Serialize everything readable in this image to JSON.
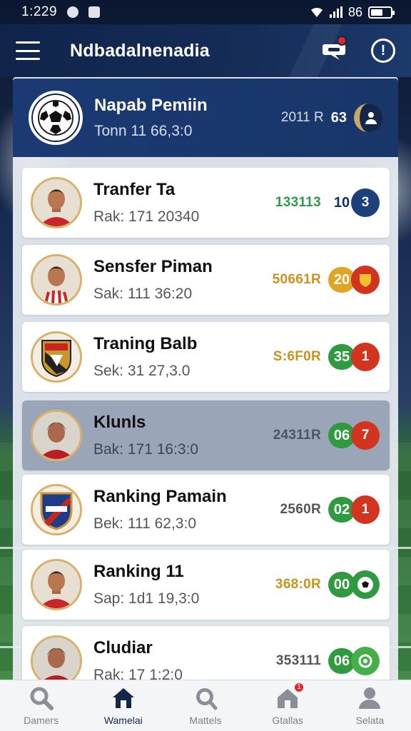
{
  "status_bar": {
    "time": "1:229",
    "battery_text": "86"
  },
  "header": {
    "title": "Ndbadalnenadia"
  },
  "featured": {
    "name": "Napab Pemiin",
    "sub": "Tonn 11 66,3:0",
    "value": "2011 R",
    "score": "63"
  },
  "rows": [
    {
      "name": "Tranfer Ta",
      "sub": "Rak: 171 20340",
      "value": "133113",
      "value_color": "#2e9a4b",
      "num": "10",
      "num_color": "transparent",
      "num_text_color": "#14306a",
      "tag": "3",
      "tag_color": "#1d3f7a",
      "avatar": "player"
    },
    {
      "name": "Sensfer Piman",
      "sub": "Sak: 111 36:20",
      "value": "50661R",
      "value_color": "#c9931c",
      "num": "20",
      "num_color": "#e0a524",
      "num_text_color": "#ffffff",
      "tag": "",
      "tag_color": "#d2341f",
      "avatar": "player-stripe"
    },
    {
      "name": "Traning Balb",
      "sub": "Sek: 31 27,3.0",
      "value": "S:6F0R",
      "value_color": "#c9931c",
      "num": "35",
      "num_color": "#2f9a3f",
      "num_text_color": "#ffffff",
      "tag": "1",
      "tag_color": "#d2341f",
      "avatar": "crest-red"
    },
    {
      "name": "Klunls",
      "sub": "Bak: 171 16:3:0",
      "value": "24311R",
      "value_color": "#4b5565",
      "num": "06",
      "num_color": "#2f9a3f",
      "num_text_color": "#ffffff",
      "tag": "7",
      "tag_color": "#d2341f",
      "avatar": "player-dark"
    },
    {
      "name": "Ranking Pamain",
      "sub": "Bek: 111 62,3:0",
      "value": "2560R",
      "value_color": "#555555",
      "num": "02",
      "num_color": "#2f9a3f",
      "num_text_color": "#ffffff",
      "tag": "1",
      "tag_color": "#d2341f",
      "avatar": "crest-blue"
    },
    {
      "name": "Ranking 11",
      "sub": "Sap: 1d1 19,3:0",
      "value": "368:0R",
      "value_color": "#c9931c",
      "num": "00",
      "num_color": "#2f9a3f",
      "num_text_color": "#ffffff",
      "tag": "",
      "tag_color": "#2f9a3f",
      "avatar": "player"
    },
    {
      "name": "Cludiar",
      "sub": "Rak: 17 1:2:0",
      "value": "353111",
      "value_color": "#555555",
      "num": "06",
      "num_color": "#2f9a3f",
      "num_text_color": "#ffffff",
      "tag": "",
      "tag_color": "#45b04a",
      "avatar": "player-dark"
    }
  ],
  "nav": [
    {
      "label": "Damers",
      "icon": "search-icon"
    },
    {
      "label": "Wamelai",
      "icon": "home-icon"
    },
    {
      "label": "Mattels",
      "icon": "matches-icon"
    },
    {
      "label": "Gtallas",
      "icon": "house-icon",
      "badge": "1"
    },
    {
      "label": "Selata",
      "icon": "profile-icon"
    }
  ]
}
